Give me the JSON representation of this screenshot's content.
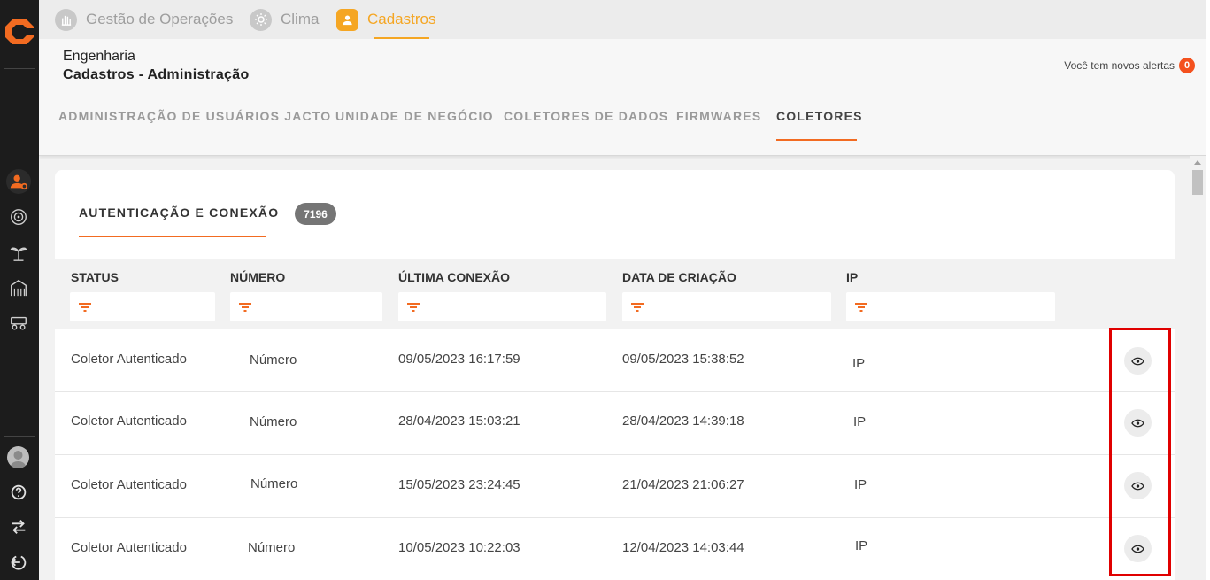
{
  "app_tabs": [
    {
      "label": "Gestão de Operações",
      "icon": "hand-icon"
    },
    {
      "label": "Clima",
      "icon": "sun-icon"
    },
    {
      "label": "Cadastros",
      "icon": "user-icon"
    }
  ],
  "header": {
    "breadcrumb_parent": "Engenharia",
    "breadcrumb_title": "Cadastros - Administração",
    "alerts_text": "Você tem novos alertas",
    "alerts_count": "0"
  },
  "nav_tabs": [
    {
      "label": "ADMINISTRAÇÃO DE USUÁRIOS JACTO"
    },
    {
      "label": "UNIDADE DE NEGÓCIO"
    },
    {
      "label": "COLETORES DE DADOS"
    },
    {
      "label": "FIRMWARES"
    },
    {
      "label": "COLETORES",
      "active": true
    }
  ],
  "section": {
    "title": "AUTENTICAÇÃO E CONEXÃO",
    "count": "7196"
  },
  "table": {
    "columns": [
      "STATUS",
      "NÚMERO",
      "ÚLTIMA CONEXÃO",
      "DATA DE CRIAÇÃO",
      "IP"
    ],
    "rows": [
      {
        "status": "Coletor Autenticado",
        "numero": "Número",
        "ultima_conexao": "09/05/2023 16:17:59",
        "data_criacao": "09/05/2023 15:38:52",
        "ip": "IP"
      },
      {
        "status": "Coletor Autenticado",
        "numero": "Número",
        "ultima_conexao": "28/04/2023 15:03:21",
        "data_criacao": "28/04/2023 14:39:18",
        "ip": "IP"
      },
      {
        "status": "Coletor Autenticado",
        "numero": "Número",
        "ultima_conexao": "15/05/2023 23:24:45",
        "data_criacao": "21/04/2023 21:06:27",
        "ip": "IP"
      },
      {
        "status": "Coletor Autenticado",
        "numero": "Número",
        "ultima_conexao": "10/05/2023 10:22:03",
        "data_criacao": "12/04/2023 14:03:44",
        "ip": "IP"
      }
    ]
  },
  "colors": {
    "accent_orange": "#f26b21",
    "app_tab_active": "#f5a623",
    "highlight_red": "#e00000",
    "sidebar_bg": "#1c1c1c"
  }
}
